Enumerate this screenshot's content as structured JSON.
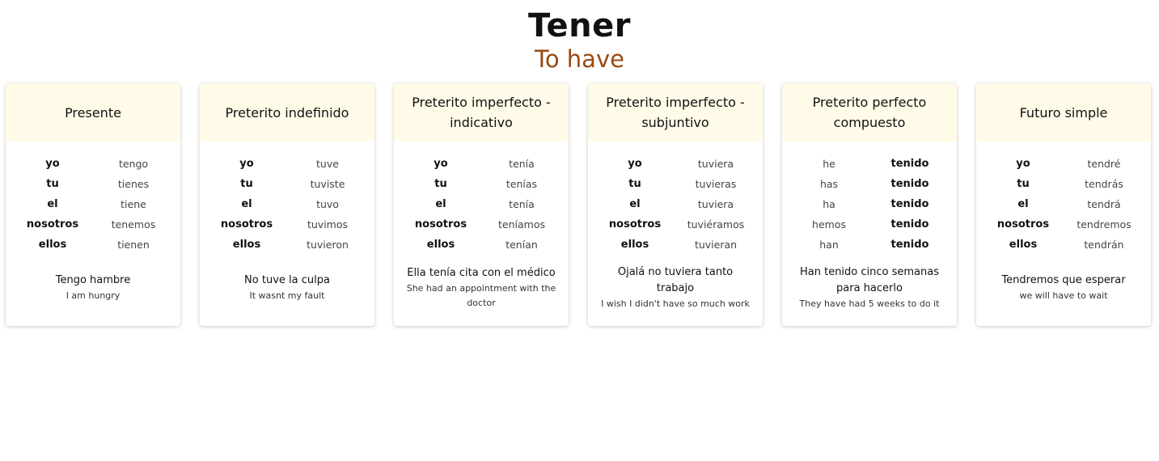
{
  "title": "Tener",
  "subtitle": "To have",
  "accent_color": "#9a4a12",
  "card_header_bg": "#fffbe8",
  "cards": [
    {
      "tense": "Presente",
      "rows": [
        [
          "yo",
          "tengo"
        ],
        [
          "tu",
          "tienes"
        ],
        [
          "el",
          "tiene"
        ],
        [
          "nosotros",
          "tenemos"
        ],
        [
          "ellos",
          "tienen"
        ]
      ],
      "bold_col": 0,
      "example_es": "Tengo hambre",
      "example_en": "I am hungry"
    },
    {
      "tense": "Preterito indefinido",
      "rows": [
        [
          "yo",
          "tuve"
        ],
        [
          "tu",
          "tuviste"
        ],
        [
          "el",
          "tuvo"
        ],
        [
          "nosotros",
          "tuvimos"
        ],
        [
          "ellos",
          "tuvieron"
        ]
      ],
      "bold_col": 0,
      "example_es": "No tuve la culpa",
      "example_en": "It wasnt my fault"
    },
    {
      "tense": "Preterito imperfecto - indicativo",
      "rows": [
        [
          "yo",
          "tenía"
        ],
        [
          "tu",
          "tenías"
        ],
        [
          "el",
          "tenía"
        ],
        [
          "nosotros",
          "teníamos"
        ],
        [
          "ellos",
          "tenían"
        ]
      ],
      "bold_col": 0,
      "example_es": "Ella tenía cita con el médico",
      "example_en": "She had an appointment with the doctor"
    },
    {
      "tense": "Preterito imperfecto - subjuntivo",
      "rows": [
        [
          "yo",
          "tuviera"
        ],
        [
          "tu",
          "tuvieras"
        ],
        [
          "el",
          "tuviera"
        ],
        [
          "nosotros",
          "tuviéramos"
        ],
        [
          "ellos",
          "tuvieran"
        ]
      ],
      "bold_col": 0,
      "example_es": "Ojalá no tuviera tanto trabajo",
      "example_en": "I wish I didn't have so much work"
    },
    {
      "tense": "Preterito perfecto compuesto",
      "rows": [
        [
          "he",
          "tenido"
        ],
        [
          "has",
          "tenido"
        ],
        [
          "ha",
          "tenido"
        ],
        [
          "hemos",
          "tenido"
        ],
        [
          "han",
          "tenido"
        ]
      ],
      "bold_col": 1,
      "example_es": "Han tenido cinco semanas para hacerlo",
      "example_en": "They have had 5 weeks to do it"
    },
    {
      "tense": "Futuro simple",
      "rows": [
        [
          "yo",
          "tendré"
        ],
        [
          "tu",
          "tendrás"
        ],
        [
          "el",
          "tendrá"
        ],
        [
          "nosotros",
          "tendremos"
        ],
        [
          "ellos",
          "tendrán"
        ]
      ],
      "bold_col": 0,
      "example_es": "Tendremos que esperar",
      "example_en": "we will have to wait"
    }
  ]
}
